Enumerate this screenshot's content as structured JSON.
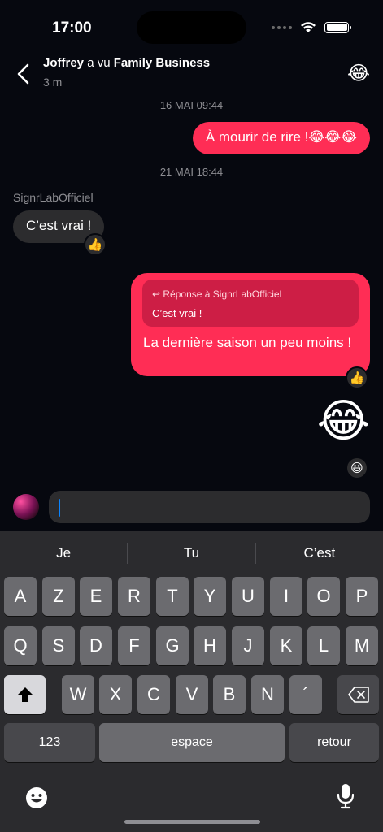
{
  "status": {
    "time": "17:00"
  },
  "header": {
    "title_name": "Joffrey",
    "title_middle": " a vu ",
    "title_show": "Family Business",
    "subtitle": "3 m",
    "emoji": "😂"
  },
  "chat": {
    "date1": "16 MAI 09:44",
    "msg1": {
      "text": "À mourir de rire !😂😂😂"
    },
    "date2": "21 MAI 18:44",
    "sender": "SignrLabOfficiel",
    "msg2": {
      "text": "C’est vrai !",
      "reaction": "👍"
    },
    "msg3": {
      "reply_header": "Réponse à SignrLabOfficiel",
      "reply_text": "C’est vrai !",
      "text": "La dernière saison un peu moins !",
      "reaction": "👍"
    },
    "msg4": {
      "emoji": "😂",
      "reaction": "😆"
    }
  },
  "composer": {
    "value": ""
  },
  "keyboard": {
    "suggestions": [
      "Je",
      "Tu",
      "C’est"
    ],
    "row1": [
      "A",
      "Z",
      "E",
      "R",
      "T",
      "Y",
      "U",
      "I",
      "O",
      "P"
    ],
    "row2": [
      "Q",
      "S",
      "D",
      "F",
      "G",
      "H",
      "J",
      "K",
      "L",
      "M"
    ],
    "row3": [
      "W",
      "X",
      "C",
      "V",
      "B",
      "N",
      "´"
    ],
    "numbers_key": "123",
    "space_key": "espace",
    "return_key": "retour"
  }
}
